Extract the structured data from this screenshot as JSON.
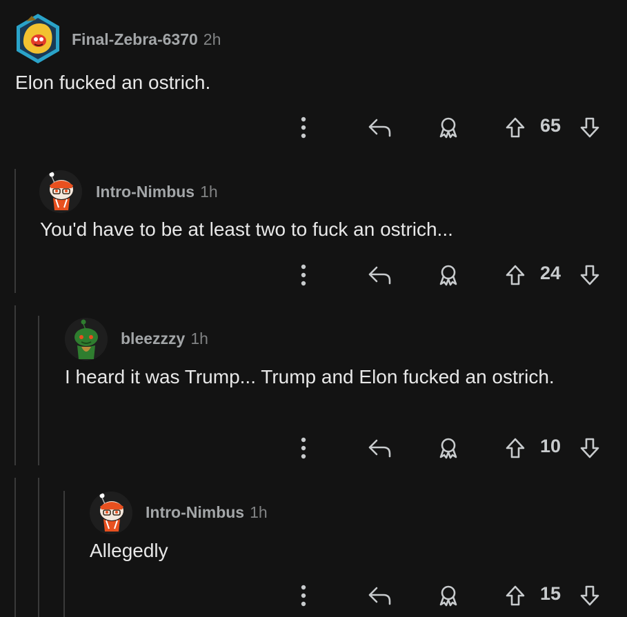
{
  "comments": [
    {
      "user": "Final-Zebra-6370",
      "time": "2h",
      "body": "Elon fucked an ostrich.",
      "score": "65"
    },
    {
      "user": "Intro-Nimbus",
      "time": "1h",
      "body": "You'd have to be at least two to fuck an ostrich...",
      "score": "24"
    },
    {
      "user": "bleezzzy",
      "time": "1h",
      "body": "I heard it was Trump... Trump and Elon fucked an ostrich.",
      "score": "10"
    },
    {
      "user": "Intro-Nimbus",
      "time": "1h",
      "body": "Allegedly",
      "score": "15"
    }
  ],
  "colors": {
    "background": "#131313",
    "text": "#e8e8e8",
    "muted": "#a3a6a8",
    "thread_line": "#3a3a3a",
    "avatar_ring": "#2aa3c9",
    "snoo_orange": "#e8501f",
    "snoo_green": "#2f7d2f"
  },
  "icons": [
    "more-options-icon",
    "reply-icon",
    "award-icon",
    "upvote-icon",
    "downvote-icon"
  ]
}
